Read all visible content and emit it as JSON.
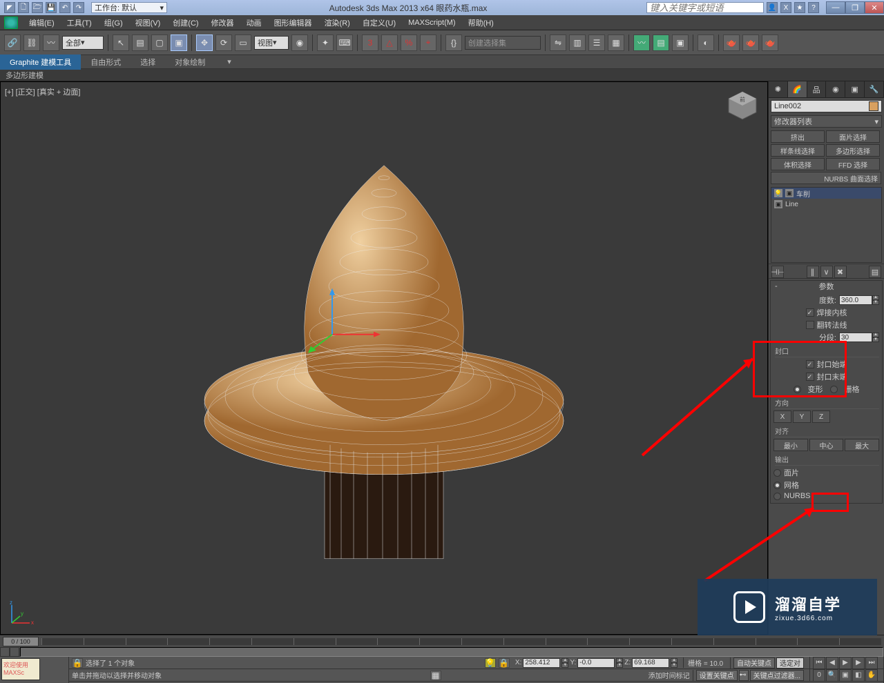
{
  "titlebar": {
    "workspace_label": "工作台: 默认",
    "app_title": "Autodesk 3ds Max  2013 x64     眼药水瓶.max",
    "search_placeholder": "键入关键字或短语"
  },
  "menu": {
    "items": [
      "编辑(E)",
      "工具(T)",
      "组(G)",
      "视图(V)",
      "创建(C)",
      "修改器",
      "动画",
      "图形编辑器",
      "渲染(R)",
      "自定义(U)",
      "MAXScript(M)",
      "帮助(H)"
    ]
  },
  "toolbar": {
    "sel_filter": "全部",
    "view_drop": "视图"
  },
  "selset_placeholder": "创建选择集",
  "ribbon": {
    "tabs": [
      "Graphite 建模工具",
      "自由形式",
      "选择",
      "对象绘制"
    ],
    "sub": "多边形建模"
  },
  "viewport": {
    "label": "[+] [正交] [真实 + 边面]"
  },
  "cmdpanel": {
    "objname": "Line002",
    "modlist_label": "修改器列表",
    "mod_sets": [
      "挤出",
      "面片选择",
      "样条线选择",
      "多边形选择",
      "体积选择",
      "FFD 选择"
    ],
    "nurbs_btn": "NURBS 曲面选择",
    "stack": {
      "mod": "车削",
      "base": "Line"
    },
    "rollout_title": "参数",
    "degrees": {
      "label": "度数:",
      "value": "360.0"
    },
    "weld": "焊接内核",
    "flip": "翻转法线",
    "segments": {
      "label": "分段:",
      "value": "30"
    },
    "cap_section": "封口",
    "cap_start": "封口始端",
    "cap_end": "封口末端",
    "morph": "变形",
    "grid": "栅格",
    "dir_section": "方向",
    "dir_x": "X",
    "dir_y": "Y",
    "dir_z": "Z",
    "align_section": "对齐",
    "align_min": "最小",
    "align_ctr": "中心",
    "align_max": "最大",
    "output_section": "输出",
    "out_patch": "面片",
    "out_mesh": "网格",
    "out_nurbs": "NURBS"
  },
  "timeline": {
    "frame": "0 / 100"
  },
  "statusbar": {
    "script_label": "欢迎使用  MAXSc",
    "msg1": "选择了 1 个对象",
    "msg2": "单击并拖动以选择并移动对象",
    "x": "258.412",
    "y": "-0.0",
    "z": "69.168",
    "grid": "栅格 = 10.0",
    "addtime": "添加时间标记",
    "autokey": "自动关键点",
    "setkey": "设置关键点",
    "keyfilter": "关键点过滤器...",
    "selset": "选定对"
  },
  "watermark": {
    "main": "溜溜自学",
    "sub": "zixue.3d66.com"
  }
}
